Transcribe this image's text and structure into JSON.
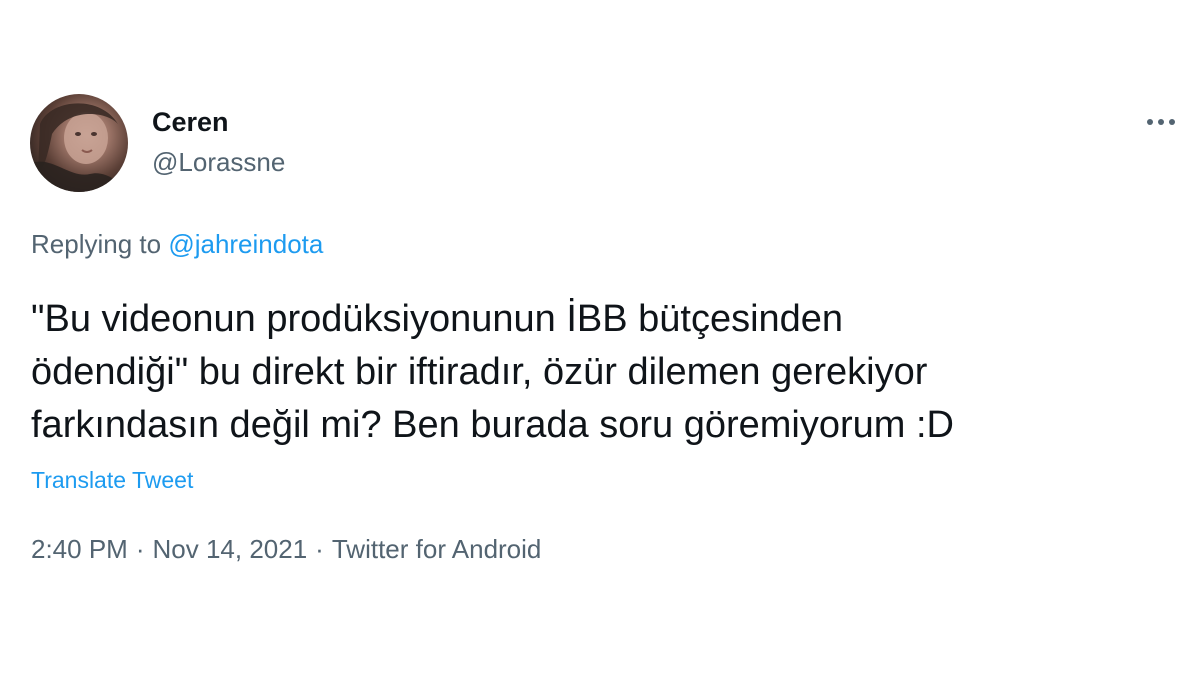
{
  "author": {
    "name": "Ceren",
    "handle": "@Lorassne"
  },
  "reply": {
    "prefix": "Replying to ",
    "mention": "@jahreindota"
  },
  "tweet": {
    "lines": [
      "\"Bu videonun prodüksiyonunun İBB bütçesinden",
      "ödendiği\" bu direkt bir iftiradır, özür dilemen gerekiyor",
      "farkındasın değil mi? Ben burada soru göremiyorum :D"
    ],
    "translate_label": "Translate Tweet"
  },
  "meta": {
    "time": "2:40 PM",
    "date": "Nov 14, 2021",
    "source": "Twitter for Android",
    "separator": "·"
  },
  "icons": {
    "more": "more-options-icon",
    "avatar": "profile-avatar"
  },
  "colors": {
    "text": "#0f1419",
    "secondary": "#536471",
    "accent": "#1d9bf0",
    "background": "#ffffff"
  }
}
